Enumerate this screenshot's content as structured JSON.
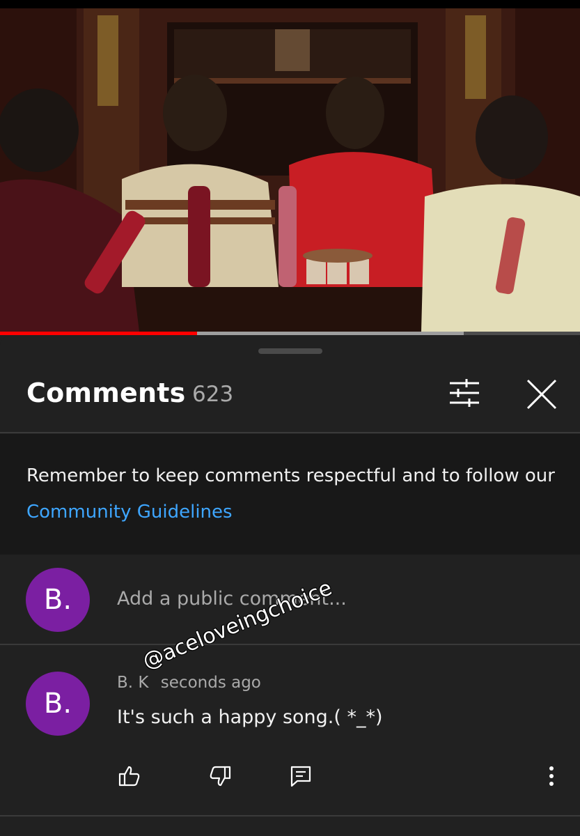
{
  "video": {
    "progress_fraction": 0.34
  },
  "comments_panel": {
    "title": "Comments",
    "count": "623",
    "notice_text": "Remember to keep comments respectful and to follow our",
    "notice_link": "Community Guidelines",
    "add_comment": {
      "avatar_letter": "B.",
      "placeholder": "Add a public comment..."
    },
    "comment": {
      "avatar_letter": "B.",
      "author": "B. K",
      "time": "seconds ago",
      "text": "It's such a happy song.( *_*)"
    }
  },
  "watermark": "@aceloveingchoice",
  "colors": {
    "accent_link": "#3ea6ff",
    "progress": "#ff0000",
    "avatar": "#7b1fa2"
  },
  "icons": [
    "filter-icon",
    "close-icon",
    "thumbs-up-icon",
    "thumbs-down-icon",
    "reply-icon",
    "more-vert-icon"
  ]
}
